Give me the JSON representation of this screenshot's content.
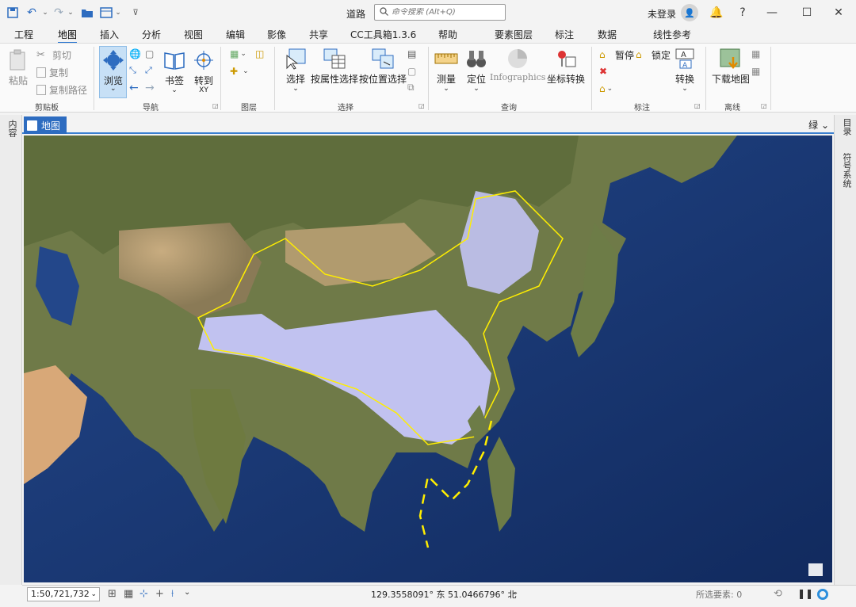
{
  "titlebar": {
    "app_title": "道路",
    "search_placeholder": "命令搜索 (Alt+Q)",
    "signin": "未登录",
    "search_icon": "search-icon",
    "quick_access": [
      "save-project-icon",
      "undo-icon",
      "redo-icon",
      "open-project-icon",
      "new-project-icon",
      "customize-icon"
    ]
  },
  "tabs": [
    "工程",
    "地图",
    "插入",
    "分析",
    "视图",
    "编辑",
    "影像",
    "共享",
    "CC工具箱1.3.6",
    "帮助",
    "要素图层",
    "标注",
    "数据",
    "线性参考"
  ],
  "active_tab": "地图",
  "ribbon": {
    "clipboard": {
      "paste": "粘贴",
      "cut": "剪切",
      "copy": "复制",
      "copy_path": "复制路径",
      "title": "剪贴板"
    },
    "navigate": {
      "browse": "浏览",
      "bookmark": "书签",
      "goto_xy": "转到",
      "goto_xy_sub": "XY",
      "title": "导航"
    },
    "layer": {
      "title": "图层"
    },
    "selection": {
      "select": "选择",
      "by_attr": "按属性选择",
      "by_location": "按位置选择",
      "title": "选择"
    },
    "inquiry": {
      "measure": "测量",
      "locate": "定位",
      "infographics": "Infographics",
      "coord_convert": "坐标转换",
      "title": "查询"
    },
    "labeling": {
      "pause": "暂停",
      "lock": "锁定",
      "convert": "转换",
      "title": "标注"
    },
    "offline": {
      "download": "下载地图",
      "title": "离线"
    }
  },
  "panes": {
    "left": "内容",
    "right_top": "目录",
    "right_bottom": "符号系统",
    "right_header": "绿"
  },
  "map_tab": "地图",
  "status": {
    "scale": "1:50,721,732",
    "coords": "129.3558091° 东 51.0466796° 北",
    "selected": "所选要素: 0"
  },
  "colors": {
    "accent": "#2d6cc0",
    "boundary": "#ffee00",
    "highlight": "#c8c8ff"
  }
}
